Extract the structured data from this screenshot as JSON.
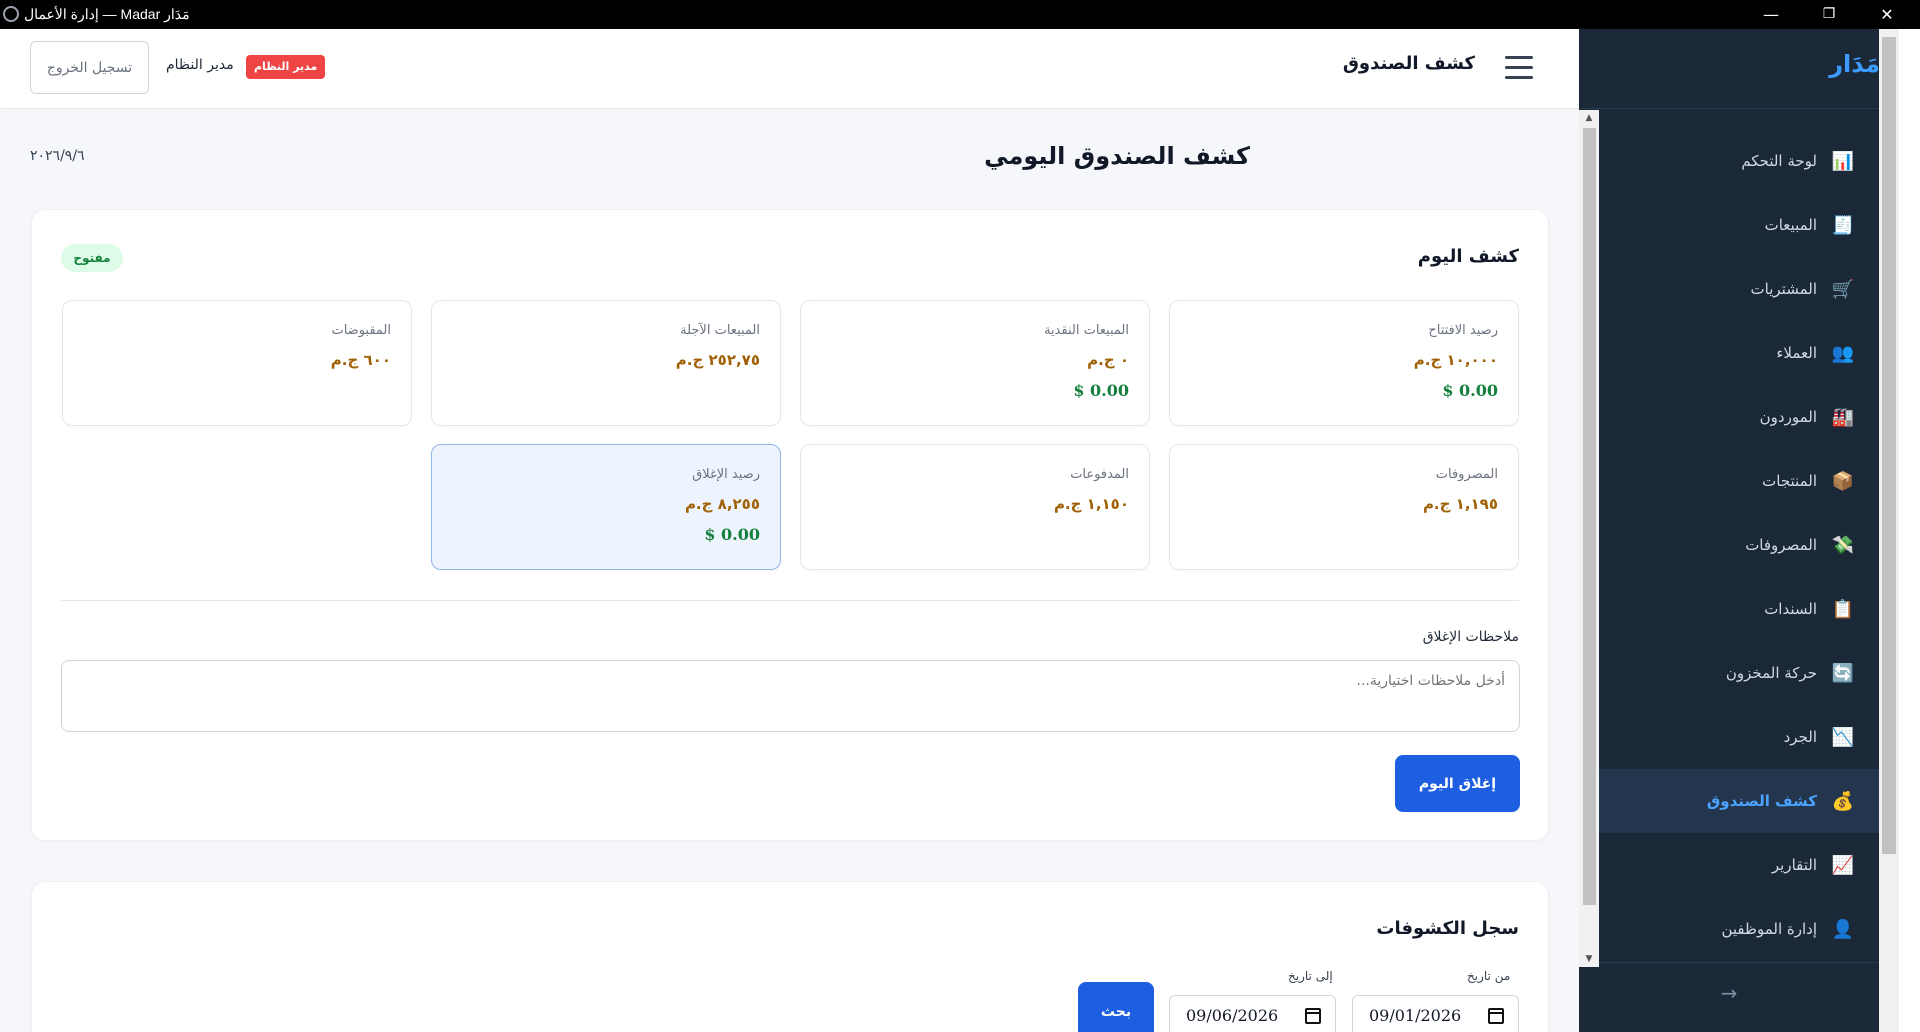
{
  "window": {
    "title": "إدارة الأعمال — Madar مَدَار",
    "minimize": "—",
    "maximize": "❐",
    "close": "✕"
  },
  "sidebar": {
    "brand": "مَدَار",
    "items": [
      {
        "label": "لوحة التحكم",
        "icon": "chart-icon",
        "glyph": "📊"
      },
      {
        "label": "المبيعات",
        "icon": "receipt-icon",
        "glyph": "🧾"
      },
      {
        "label": "المشتريات",
        "icon": "cart-icon",
        "glyph": "🛒"
      },
      {
        "label": "العملاء",
        "icon": "users-icon",
        "glyph": "👥"
      },
      {
        "label": "الموردون",
        "icon": "factory-icon",
        "glyph": "🏭"
      },
      {
        "label": "المنتجات",
        "icon": "box-icon",
        "glyph": "📦"
      },
      {
        "label": "المصروفات",
        "icon": "money-icon",
        "glyph": "💸"
      },
      {
        "label": "السندات",
        "icon": "clipboard-icon",
        "glyph": "📋"
      },
      {
        "label": "حركة المخزون",
        "icon": "refresh-icon",
        "glyph": "🔄"
      },
      {
        "label": "الجرد",
        "icon": "chart-down-icon",
        "glyph": "📉"
      },
      {
        "label": "كشف الصندوق",
        "icon": "money-bag-icon",
        "glyph": "💰",
        "active": true
      },
      {
        "label": "التقارير",
        "icon": "chart-up-icon",
        "glyph": "📈"
      },
      {
        "label": "إدارة الموظفين",
        "icon": "person-icon",
        "glyph": "👤"
      }
    ],
    "footer_arrow": "→"
  },
  "topbar": {
    "page_title": "كشف الصندوق",
    "logout_label": "تسجيل الخروج",
    "user_name": "مدير النظام",
    "role_badge": "مدير النظام"
  },
  "page": {
    "heading": "كشف الصندوق اليومي",
    "date": "٢٠٢٦/٩/٦"
  },
  "today_card": {
    "title": "كشف اليوم",
    "status": "مفتوح",
    "stats": [
      {
        "label": "رصيد الافتتاح",
        "value": "١٠,٠٠٠ ج.م",
        "extra": "$ 0.00"
      },
      {
        "label": "المبيعات النقدية",
        "value": "٠ ج.م",
        "extra": "$ 0.00"
      },
      {
        "label": "المبيعات الآجلة",
        "value": "٢٥٢,٧٥ ج.م"
      },
      {
        "label": "المقبوضات",
        "value": "٦٠٠ ج.م"
      },
      {
        "label": "المصروفات",
        "value": "١,١٩٥ ج.م"
      },
      {
        "label": "المدفوعات",
        "value": "١,١٥٠ ج.م"
      },
      {
        "label": "رصيد الإغلاق",
        "value": "٨,٢٥٥ ج.م",
        "extra": "$ 0.00"
      }
    ],
    "notes_label": "ملاحظات الإغلاق",
    "notes_placeholder": "أدخل ملاحظات اختيارية...",
    "close_button": "إغلاق اليوم"
  },
  "history_card": {
    "title": "سجل الكشوفات",
    "from_label": "من تاريخ",
    "from_value": "09/01/2026",
    "to_label": "إلى تاريخ",
    "to_value": "09/06/2026",
    "search_button": "بحث"
  }
}
